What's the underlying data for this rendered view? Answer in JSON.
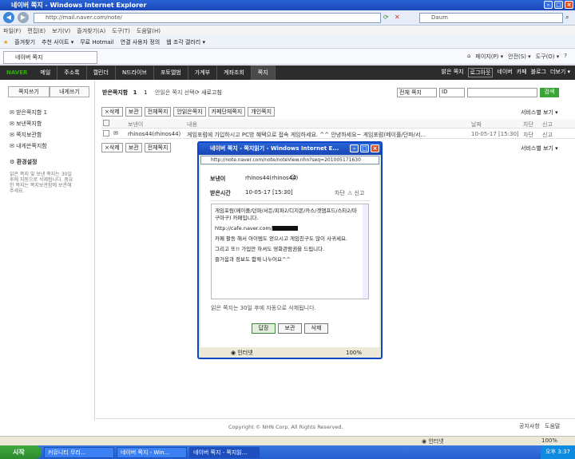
{
  "window": {
    "title": "네이버 쪽지 - Windows Internet Explorer"
  },
  "browser": {
    "url": "http://mail.naver.com/note/",
    "search_placeholder": "Daum",
    "menu": [
      "파일(F)",
      "편집(E)",
      "보기(V)",
      "즐겨찾기(A)",
      "도구(T)",
      "도움말(H)"
    ],
    "favorites": [
      "즐겨찾기",
      "추천 사이트 ▾",
      "무료 Hotmail",
      "연결 사용자 정의",
      "웹 조각 갤러리 ▾"
    ],
    "tab": "네이버 쪽지",
    "commands": [
      "페이지(P) ▾",
      "안전(S) ▾",
      "도구(O) ▾"
    ]
  },
  "gnb": {
    "logo": "NAVER",
    "items": [
      "메일",
      "주소록",
      "캘린더",
      "N드라이브",
      "포토앨범",
      "가계부",
      "계좌조회",
      "쪽지"
    ],
    "right": [
      "밝은 쪽지",
      "로그아웃",
      "네이버",
      "카페",
      "블로그",
      "더보기 ▾"
    ]
  },
  "sidebar": {
    "write": "쪽지쓰기",
    "to_me": "내게쓰기",
    "boxes": [
      "받은쪽지함 1",
      "보낸쪽지함",
      "쪽지보관함",
      "내게쓴쪽지함"
    ],
    "settings": "환경설정",
    "notice": "읽은 쪽지 및 보낸 쪽지는 30일후에 자동으로 삭제됩니다. 중요한 쪽지는 쪽지보관함에 보관해 주세요."
  },
  "content": {
    "header": "받은쪽지함",
    "count": "1",
    "unread": "1",
    "unread_label": "안읽은 쪽지 선택",
    "refresh": "새로고침",
    "filter": "전체 쪽지",
    "field": "ID",
    "search_btn": "검색",
    "toolbar": [
      "×삭제",
      "보관",
      "전체쪽지",
      "안읽은쪽지",
      "카페단체쪽지",
      "개인쪽지"
    ],
    "service": "서비스별 보기 ▾",
    "columns": [
      "보낸이",
      "내용",
      "날짜",
      "차단",
      "신고"
    ],
    "rows": [
      {
        "sender": "rhinos44(rhinos44)",
        "text": "게임포럼에 가입하시고 PC방 혜택으로 접속 게임하세요. ^^ 안녕하세요~ 게임포럼(메이플/던파/서...",
        "date": "10-05-17 [15:30]",
        "block": "차단",
        "report": "신고"
      }
    ],
    "copyright": "Copyright © NHN Corp. All Rights Reserved.",
    "footer_links": [
      "공지사항",
      "도움말"
    ]
  },
  "popup": {
    "title": "네이버 쪽지 - 쪽지읽기 - Windows Internet E...",
    "url": "http://note.naver.com/note/noteView.nhn?seq=201005171630",
    "sender_label": "보낸이",
    "sender": "rhinos44(rhinos44)",
    "time_label": "받은시간",
    "time": "10-05-17 [15:30]",
    "block": "차단",
    "report": "신고",
    "message": [
      "게임포럼(메이플/던파/서든/피파2/디지몬/카스/겟앰프드/스타2/마구마구) 카페입니다.",
      "http://cafe.naver.com/",
      "카페 활동 해서 아이템도 얻으시고 게임친구도 많이 사귀세요.",
      "그리고 또!! 가입만 하셔도 영화관람권을 드립니다.",
      "즐거움과 정보도 함께 나누어요^^"
    ],
    "note": "읽은 쪽지는 30일 후에 자동으로 삭제됩니다.",
    "buttons": [
      "답장",
      "보관",
      "삭제"
    ],
    "status": "인터넷",
    "zoom": "100%"
  },
  "statusbar": {
    "zone": "인터넷",
    "zoom": "100%"
  },
  "taskbar": {
    "start": "시작",
    "tasks": [
      "커뮤니티 무리...",
      "네이버 쪽지 - Win...",
      "네이버 쪽지 - 쪽지읽..."
    ],
    "clock": "오후 3:37"
  }
}
